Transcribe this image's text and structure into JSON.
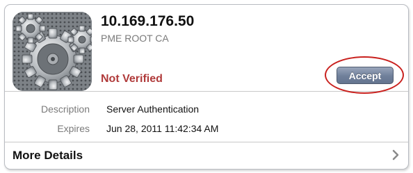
{
  "certificate": {
    "title": "10.169.176.50",
    "issuer": "PME ROOT CA",
    "status": "Not Verified",
    "accept_label": "Accept",
    "icon": "settings-gears-icon"
  },
  "details": [
    {
      "label": "Description",
      "value": "Server Authentication"
    },
    {
      "label": "Expires",
      "value": "Jun 28, 2011 11:42:34 AM"
    }
  ],
  "more_details": {
    "label": "More Details",
    "icon": "chevron-right-icon"
  },
  "colors": {
    "status_red": "#b03a3a",
    "accept_blue": "#6f7f9a",
    "highlight_ring": "#c9211e"
  }
}
